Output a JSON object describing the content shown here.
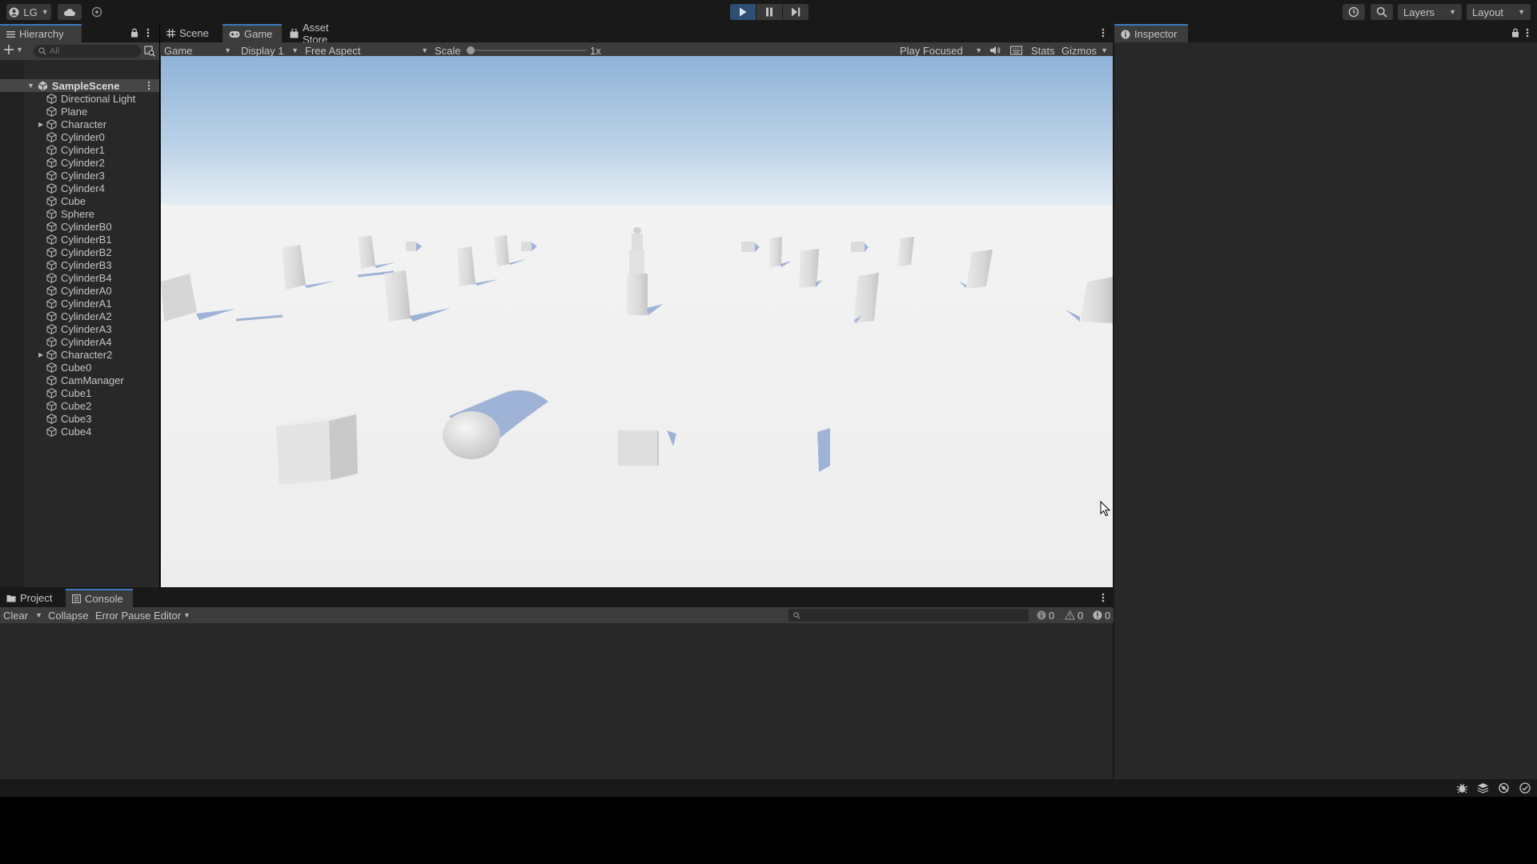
{
  "toolbar": {
    "account": "LG",
    "layers": "Layers",
    "layout": "Layout"
  },
  "hierarchy": {
    "tab": "Hierarchy",
    "search_placeholder": "All",
    "scene": "SampleScene",
    "items": [
      {
        "label": "Directional Light",
        "expandable": false
      },
      {
        "label": "Plane",
        "expandable": false
      },
      {
        "label": "Character",
        "expandable": true
      },
      {
        "label": "Cylinder0",
        "expandable": false
      },
      {
        "label": "Cylinder1",
        "expandable": false
      },
      {
        "label": "Cylinder2",
        "expandable": false
      },
      {
        "label": "Cylinder3",
        "expandable": false
      },
      {
        "label": "Cylinder4",
        "expandable": false
      },
      {
        "label": "Cube",
        "expandable": false
      },
      {
        "label": "Sphere",
        "expandable": false
      },
      {
        "label": "CylinderB0",
        "expandable": false
      },
      {
        "label": "CylinderB1",
        "expandable": false
      },
      {
        "label": "CylinderB2",
        "expandable": false
      },
      {
        "label": "CylinderB3",
        "expandable": false
      },
      {
        "label": "CylinderB4",
        "expandable": false
      },
      {
        "label": "CylinderA0",
        "expandable": false
      },
      {
        "label": "CylinderA1",
        "expandable": false
      },
      {
        "label": "CylinderA2",
        "expandable": false
      },
      {
        "label": "CylinderA3",
        "expandable": false
      },
      {
        "label": "CylinderA4",
        "expandable": false
      },
      {
        "label": "Character2",
        "expandable": true
      },
      {
        "label": "Cube0",
        "expandable": false
      },
      {
        "label": "CamManager",
        "expandable": false
      },
      {
        "label": "Cube1",
        "expandable": false
      },
      {
        "label": "Cube2",
        "expandable": false
      },
      {
        "label": "Cube3",
        "expandable": false
      },
      {
        "label": "Cube4",
        "expandable": false
      }
    ]
  },
  "view_tabs": {
    "scene": "Scene",
    "game": "Game",
    "asset_store": "Asset Store"
  },
  "game_bar": {
    "mode": "Game",
    "display": "Display 1",
    "aspect": "Free Aspect",
    "scale_label": "Scale",
    "scale_value": "1x",
    "play_mode": "Play Focused",
    "stats": "Stats",
    "gizmos": "Gizmos"
  },
  "inspector": {
    "tab": "Inspector"
  },
  "bottom_tabs": {
    "project": "Project",
    "console": "Console"
  },
  "console": {
    "clear": "Clear",
    "collapse": "Collapse",
    "error_pause": "Error Pause",
    "editor": "Editor",
    "info_count": "0",
    "warning_count": "0",
    "error_count": "0"
  },
  "colors": {
    "accent": "#3a79bb",
    "play_active": "#2e4f73"
  }
}
